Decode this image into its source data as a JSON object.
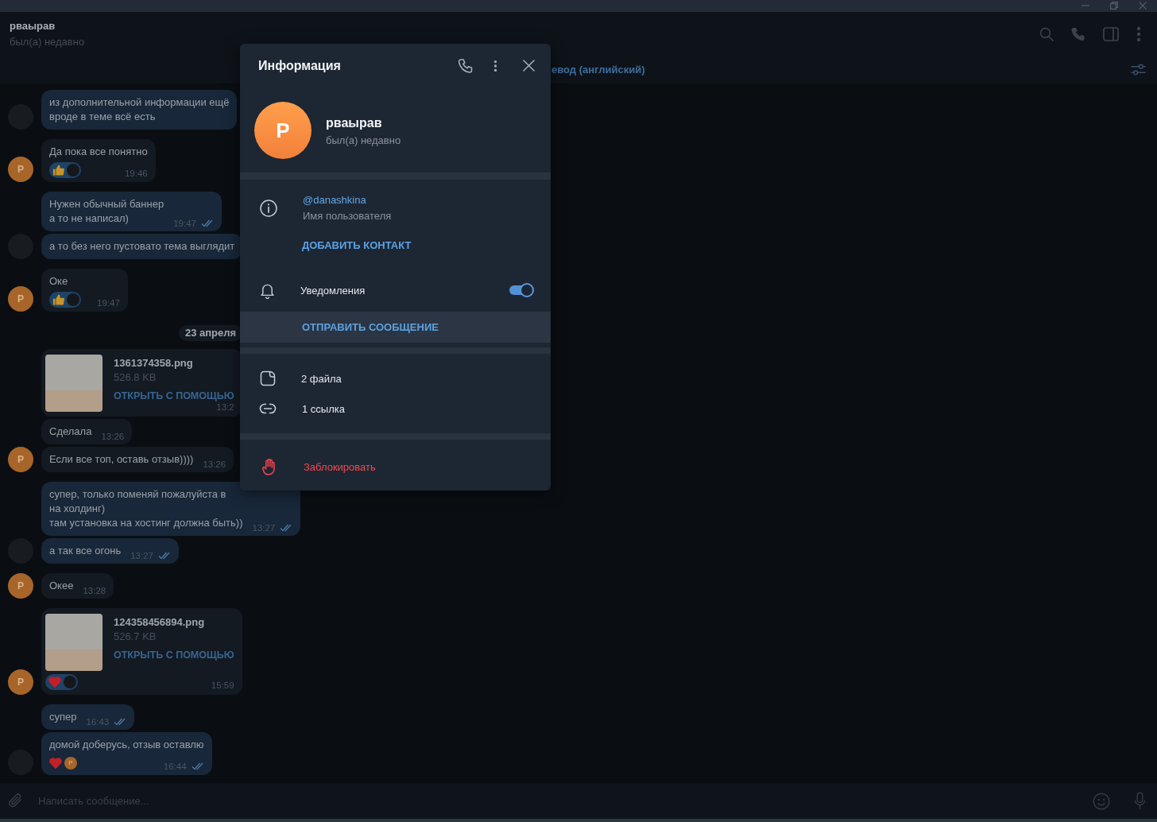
{
  "header": {
    "name": "рваырав",
    "status": "был(а) недавно"
  },
  "translate_bar": {
    "text": "евод (английский)"
  },
  "messages": [
    {
      "kind": "outgoing",
      "text": "из дополнительной информации ещё\nвроде в теме всё есть",
      "avatar": {
        "kind": "photo"
      }
    },
    {
      "kind": "incoming",
      "text": "Да пока все понятно",
      "reactions": [
        {
          "kind": "like",
          "by": {
            "kind": "photo"
          }
        }
      ],
      "time": "19:46",
      "avatar": {
        "kind": "letter",
        "letter": "Р"
      }
    },
    {
      "kind": "outgoing",
      "text": "Нужен обычный баннер\nа то не написал)",
      "time": "19:47",
      "read": true
    },
    {
      "kind": "outgoing",
      "text": "а то без него пустовато тема выглядит",
      "avatar": {
        "kind": "photo"
      }
    },
    {
      "kind": "incoming",
      "text": "Оке",
      "reactions": [
        {
          "kind": "like",
          "by": {
            "kind": "photo"
          }
        }
      ],
      "time": "19:47",
      "avatar": {
        "kind": "letter",
        "letter": "Р"
      }
    },
    {
      "kind": "date",
      "text": "23 апреля"
    },
    {
      "kind": "incoming",
      "file": {
        "name": "1361374358.png",
        "size": "526.8 KB",
        "action": "ОТКРЫТЬ С ПОМОЩЬЮ"
      },
      "time": "13:2"
    },
    {
      "kind": "incoming",
      "text": "Сделала",
      "time": "13:26"
    },
    {
      "kind": "incoming",
      "text": "Если все топ, оставь отзыв))))",
      "time": "13:26",
      "avatar": {
        "kind": "letter",
        "letter": "Р"
      }
    },
    {
      "kind": "outgoing",
      "text": "супер, только поменяй пожалуйста в\nна холдинг)\nтам установка на хостинг должна быть))",
      "time": "13:27",
      "read": true
    },
    {
      "kind": "outgoing",
      "text": "а так все огонь",
      "time": "13:27",
      "read": true,
      "avatar": {
        "kind": "photo"
      }
    },
    {
      "kind": "incoming",
      "text": "Окее",
      "time": "13:28",
      "avatar": {
        "kind": "letter",
        "letter": "Р"
      }
    },
    {
      "kind": "incoming",
      "file": {
        "name": "124358456894.png",
        "size": "526.7 KB",
        "action": "ОТКРЫТЬ С ПОМОЩЬЮ"
      },
      "reactions": [
        {
          "kind": "heart",
          "by": {
            "kind": "photo"
          }
        }
      ],
      "time": "15:59",
      "avatar": {
        "kind": "letter",
        "letter": "Р"
      }
    },
    {
      "kind": "outgoing",
      "text": "супер",
      "time": "16:43",
      "read": true
    },
    {
      "kind": "outgoing",
      "text": "домой доберусь, отзыв оставлю",
      "reactions": [
        {
          "kind": "heart",
          "by": {
            "kind": "letter",
            "letter": "Р"
          }
        }
      ],
      "time": "16:44",
      "read": true,
      "avatar": {
        "kind": "photo"
      }
    }
  ],
  "composer": {
    "placeholder": "Написать сообщение..."
  },
  "info_panel": {
    "title": "Информация",
    "profile": {
      "letter": "Р",
      "name": "рваырав",
      "status": "был(а) недавно"
    },
    "username": {
      "value": "@danashkina",
      "caption": "Имя пользователя"
    },
    "add_contact": "ДОБАВИТЬ КОНТАКТ",
    "notifications": {
      "label": "Уведомления",
      "on": true
    },
    "send_message": {
      "label": "ОТПРАВИТЬ СООБЩЕНИЕ",
      "highlighted": true
    },
    "media": [
      {
        "kind": "files",
        "label": "2 файла"
      },
      {
        "kind": "links",
        "label": "1 ссылка"
      }
    ],
    "block": "Заблокировать"
  }
}
